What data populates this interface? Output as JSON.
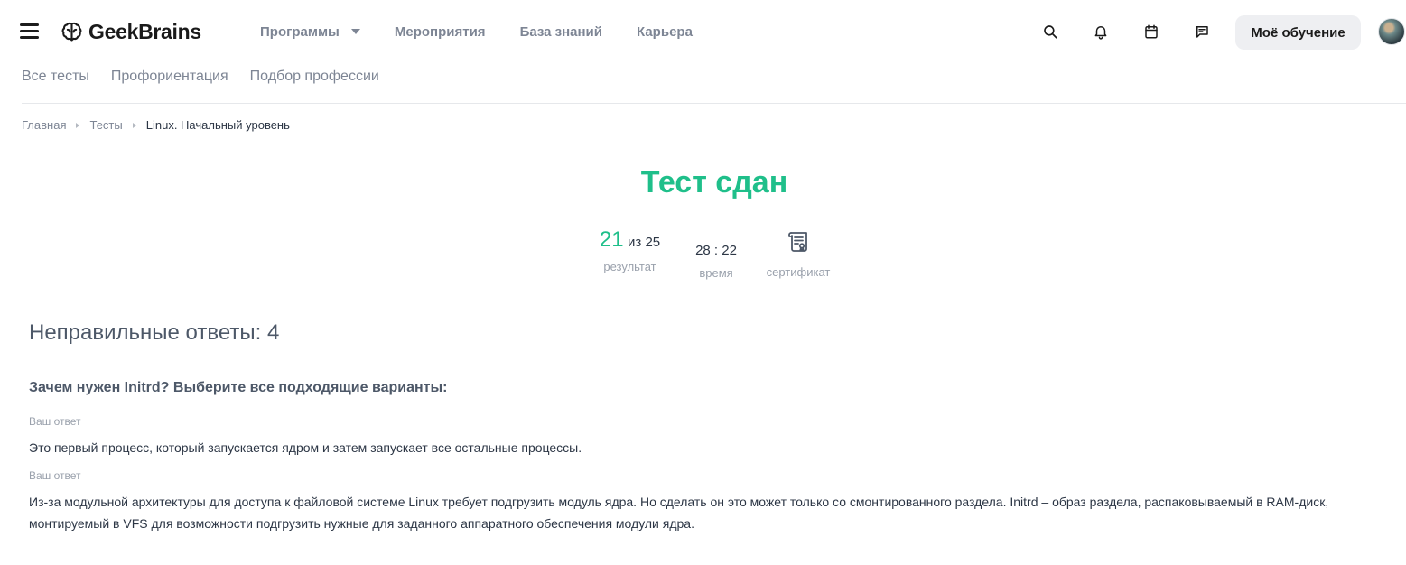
{
  "header": {
    "logo_text": "GeekBrains",
    "nav": [
      {
        "label": "Программы",
        "has_dropdown": true
      },
      {
        "label": "Мероприятия"
      },
      {
        "label": "База знаний"
      },
      {
        "label": "Карьера"
      }
    ],
    "icons": [
      "search-icon",
      "bell-icon",
      "calendar-icon",
      "chat-icon"
    ],
    "learning_button": "Моё обучение"
  },
  "subnav": [
    "Все тесты",
    "Профориентация",
    "Подбор профессии"
  ],
  "breadcrumb": {
    "home": "Главная",
    "tests": "Тесты",
    "current": "Linux. Начальный уровень"
  },
  "result": {
    "title": "Тест сдан",
    "score": "21",
    "score_total": "из 25",
    "score_label": "результат",
    "time": "28 : 22",
    "time_label": "время",
    "certificate_label": "сертификат"
  },
  "wrong": {
    "heading": "Неправильные ответы: 4",
    "question": "Зачем нужен Initrd? Выберите все подходящие варианты:",
    "answers": [
      {
        "label": "Ваш ответ",
        "text": "Это первый процесс, который запускается ядром и затем запускает все остальные процессы."
      },
      {
        "label": "Ваш ответ",
        "text": "Из-за модульной архитектуры для доступа к файловой системе Linux требует подгрузить модуль ядра. Но сделать он это может только со смонтированного раздела. Initrd – образ раздела, распаковываемый в RAM-диск, монтируемый в VFS для возможности подгрузить нужные для заданного аппаратного обеспечения модули ядра."
      }
    ]
  },
  "colors": {
    "accent_green": "#1fbf8a",
    "muted_text": "#7d8594",
    "button_bg": "#eeeff2"
  }
}
